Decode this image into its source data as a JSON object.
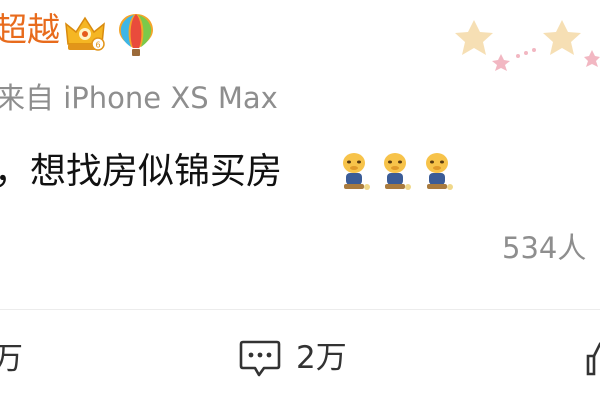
{
  "post": {
    "username": "超越",
    "badges": [
      "crown-badge-icon",
      "balloon-badge-icon"
    ],
    "source": "来自 iPhone XS Max",
    "text": "，想找房似锦买房",
    "emojis": [
      "doge-sitting-emoji",
      "doge-sitting-emoji",
      "doge-sitting-emoji"
    ],
    "read_count": "534人"
  },
  "actions": {
    "repost_count": "万",
    "comment_count": "2万"
  },
  "colors": {
    "username": "#e86b1c",
    "secondary_text": "#8e8e8e",
    "star_yellow": "#f6dfb4",
    "star_pink": "#f2b7c2"
  }
}
